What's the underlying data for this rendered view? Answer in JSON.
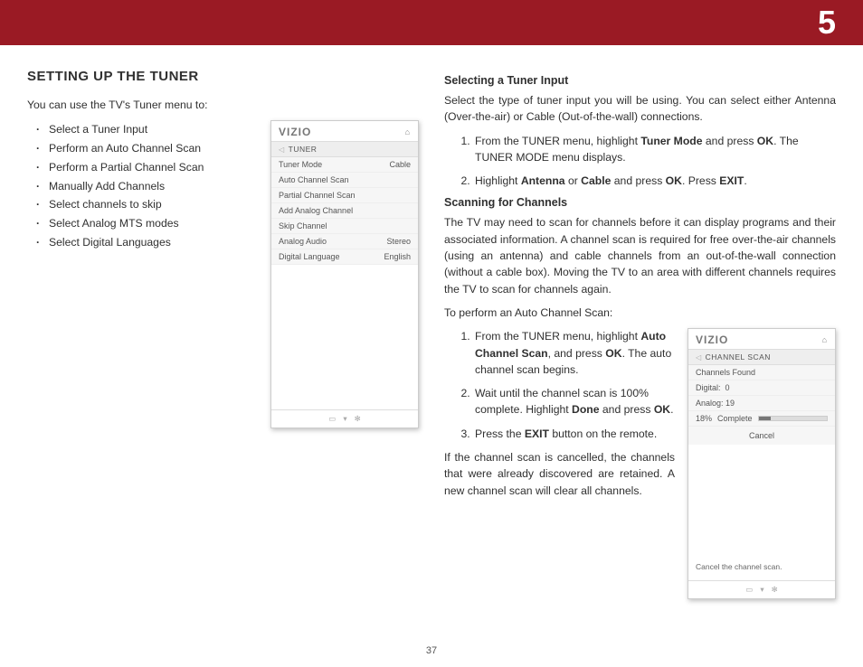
{
  "chapter_number": "5",
  "page_number": "37",
  "section_title": "SETTING UP THE TUNER",
  "intro_text": "You can use the TV's Tuner menu to:",
  "bullets": [
    "Select a Tuner Input",
    "Perform an Auto Channel Scan",
    "Perform a Partial Channel Scan",
    "Manually Add Channels",
    "Select channels to skip",
    "Select Analog MTS modes",
    "Select Digital Languages"
  ],
  "tuner_menu": {
    "brand": "VIZIO",
    "crumb": "TUNER",
    "rows": [
      {
        "label": "Tuner Mode",
        "value": "Cable"
      },
      {
        "label": "Auto Channel Scan",
        "value": ""
      },
      {
        "label": "Partial Channel Scan",
        "value": ""
      },
      {
        "label": "Add Analog Channel",
        "value": ""
      },
      {
        "label": "Skip Channel",
        "value": ""
      },
      {
        "label": "Analog Audio",
        "value": "Stereo"
      },
      {
        "label": "Digital Language",
        "value": "English"
      }
    ]
  },
  "right": {
    "h1": "Selecting a Tuner Input",
    "p1": "Select the type of tuner input you will be using. You can select either Antenna (Over-the-air) or Cable (Out-of-the-wall) connections.",
    "step1a": "From the TUNER menu, highlight ",
    "step1b": "Tuner Mode",
    "step1c": " and press ",
    "step1d": "OK",
    "step1e": ". The TUNER MODE menu displays.",
    "step2a": "Highlight ",
    "step2b": "Antenna",
    "step2c": " or ",
    "step2d": "Cable",
    "step2e": " and press ",
    "step2f": "OK",
    "step2g": ". Press ",
    "step2h": "EXIT",
    "step2i": ".",
    "h2": "Scanning for Channels",
    "p2": "The TV may need to scan for channels before it can display programs and their associated information. A channel scan is required for free over-the-air channels (using an antenna) and cable channels from an out-of-the-wall connection (without a cable box). Moving the TV to an area with different channels requires the TV to scan for channels again.",
    "p3": "To perform an Auto Channel Scan:",
    "scan_steps": {
      "s1a": "From the TUNER menu, highlight ",
      "s1b": "Auto Channel Scan",
      "s1c": ", and press ",
      "s1d": "OK",
      "s1e": ". The auto channel scan begins.",
      "s2a": "Wait until the channel scan is 100% complete. Highlight ",
      "s2b": "Done",
      "s2c": " and press ",
      "s2d": "OK",
      "s2e": ".",
      "s3a": "Press the ",
      "s3b": "EXIT",
      "s3c": " button on the remote."
    },
    "p4": "If the channel scan is cancelled, the channels that were already discovered are retained. A new channel scan will clear all channels."
  },
  "scan_menu": {
    "brand": "VIZIO",
    "crumb": "CHANNEL SCAN",
    "found_label": "Channels Found",
    "digital_label": "Digital:",
    "digital_value": "0",
    "analog_label": "Analog:",
    "analog_value": "19",
    "percent": "18%",
    "complete": "Complete",
    "progress_width_pct": 18,
    "cancel": "Cancel",
    "hint": "Cancel the channel scan."
  }
}
